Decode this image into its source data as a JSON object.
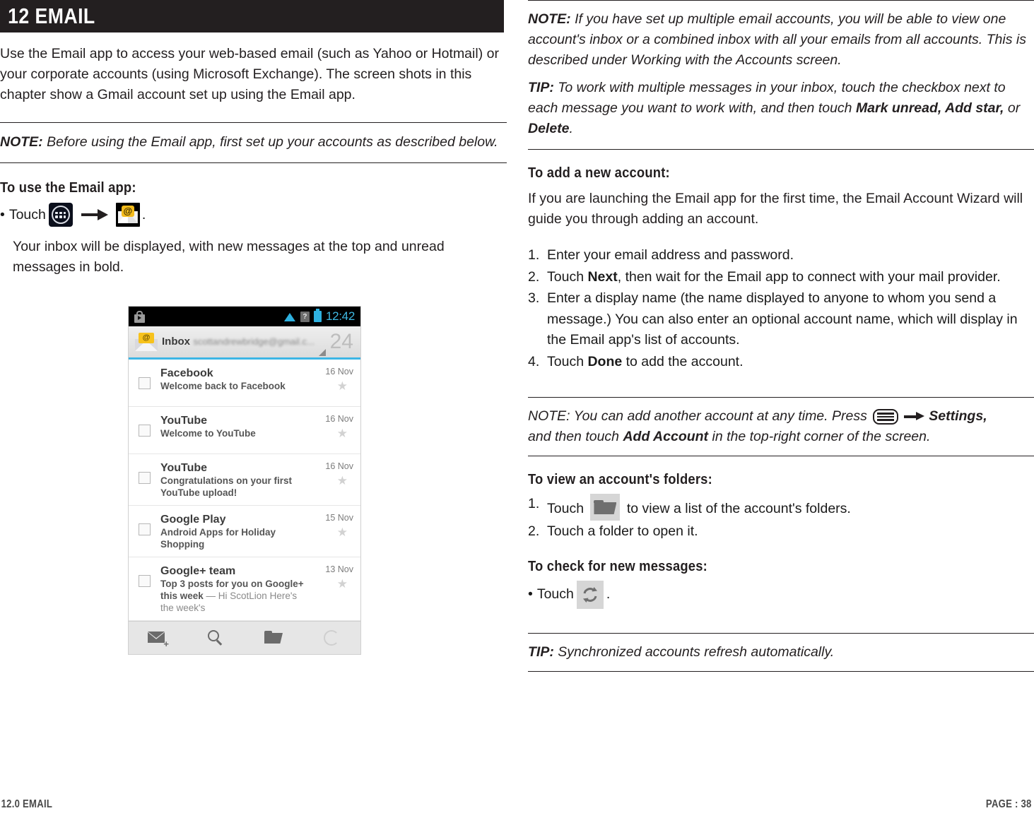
{
  "chapter": {
    "header_title": "12 EMAIL",
    "header_bg": "#231f20"
  },
  "left": {
    "intro": "Use the Email app to access your web-based email (such as Yahoo or Hotmail) or your corporate accounts (using Microsoft Exchange). The screen shots in this chapter show a Gmail account set up using the Email app.",
    "note1_lead": "NOTE:",
    "note1_text": " Before using the Email app, first set up your accounts as described below.",
    "use_heading": "To use the Email app:",
    "touch_bullet": "•",
    "touch_label": "Touch",
    "touch_period": ".",
    "inbox_result": "Your inbox will be displayed, with new messages at the top and unread messages in bold."
  },
  "phone": {
    "status": {
      "time": "12:42",
      "notification_icon": "play-store-icon",
      "wifi_icon": "wifi-icon",
      "signal_icon": "signal-unknown-icon",
      "signal_glyph": "?",
      "battery_icon": "battery-icon"
    },
    "inbox_header": {
      "title": "Inbox",
      "account": "scottandrewbridge@gmail.c...",
      "unread_count": "24",
      "accent_color": "#3db6e5"
    },
    "messages": [
      {
        "sender": "Facebook",
        "subject": "Welcome back to Facebook",
        "snippet": "",
        "date": "16 Nov",
        "starred": false
      },
      {
        "sender": "YouTube",
        "subject": "Welcome to YouTube",
        "snippet": "",
        "date": "16 Nov",
        "starred": false
      },
      {
        "sender": "YouTube",
        "subject": "Congratulations on your first YouTube upload!",
        "snippet": "",
        "date": "16 Nov",
        "starred": false
      },
      {
        "sender": "Google Play",
        "subject": "Android Apps for Holiday Shopping",
        "snippet": "",
        "date": "15 Nov",
        "starred": false
      },
      {
        "sender": "Google+ team",
        "subject": "Top 3 posts for you on Google+ this week",
        "snippet": " — Hi ScotLion Here's the week's",
        "date": "13 Nov",
        "starred": false
      }
    ],
    "toolbar": [
      {
        "name": "compose-icon",
        "label": "Compose"
      },
      {
        "name": "search-icon",
        "label": "Search"
      },
      {
        "name": "folders-icon",
        "label": "Folders"
      },
      {
        "name": "refresh-icon",
        "label": "Refresh"
      }
    ]
  },
  "right": {
    "note_multi_lead": "NOTE:",
    "note_multi_text": " If you have set up multiple email accounts, you will be able to view one account's inbox or a combined inbox with all your emails from all accounts. This is described under Working with the Accounts screen.",
    "tip_multi_lead": "TIP:",
    "tip_multi_a": " To work with multiple messages in your inbox, touch the checkbox next to each message you want to work with, and then touch ",
    "tip_multi_b1": "Mark unread, Add star,",
    "tip_multi_c": " or ",
    "tip_multi_b2": "Delete",
    "tip_multi_d": ".",
    "add_heading": "To add a new account:",
    "add_intro": "If you are launching the Email app for the first time, the Email Account Wizard will guide you through adding an account.",
    "steps": [
      {
        "num": "1.",
        "pre": "Enter your email address and password.",
        "bold": "",
        "post": ""
      },
      {
        "num": "2.",
        "pre": "Touch ",
        "bold": "Next",
        "post": ", then wait for the Email app to connect with your mail provider."
      },
      {
        "num": "3.",
        "pre": "Enter a display name (the name displayed to anyone to whom you send a message.) You can also enter an optional account name, which will display in the Email app's list of accounts.",
        "bold": "",
        "post": ""
      },
      {
        "num": "4.",
        "pre": "Touch ",
        "bold": "Done",
        "post": " to add the account."
      }
    ],
    "note_another_lead": "NOTE:",
    "note_another_a": " You can add another account at any time. Press ",
    "note_another_b": "Settings,",
    "note_another_c": "and then touch ",
    "note_another_d": "Add Account",
    "note_another_e": " in the top-right corner of the screen.",
    "folders_heading": "To view an account's folders:",
    "folders_steps": [
      {
        "num": "1.",
        "pre": "Touch ",
        "post": " to view a list of the account's folders."
      },
      {
        "num": "2.",
        "pre": "Touch a folder to open it.",
        "post": ""
      }
    ],
    "check_heading": "To check for new messages:",
    "check_bullet": "•",
    "check_label": "Touch",
    "check_period": ".",
    "tip_sync_lead": "TIP:",
    "tip_sync_text": " Synchronized accounts refresh automatically."
  },
  "footer": {
    "left": "12.0 EMAIL",
    "right": "PAGE : 38"
  }
}
